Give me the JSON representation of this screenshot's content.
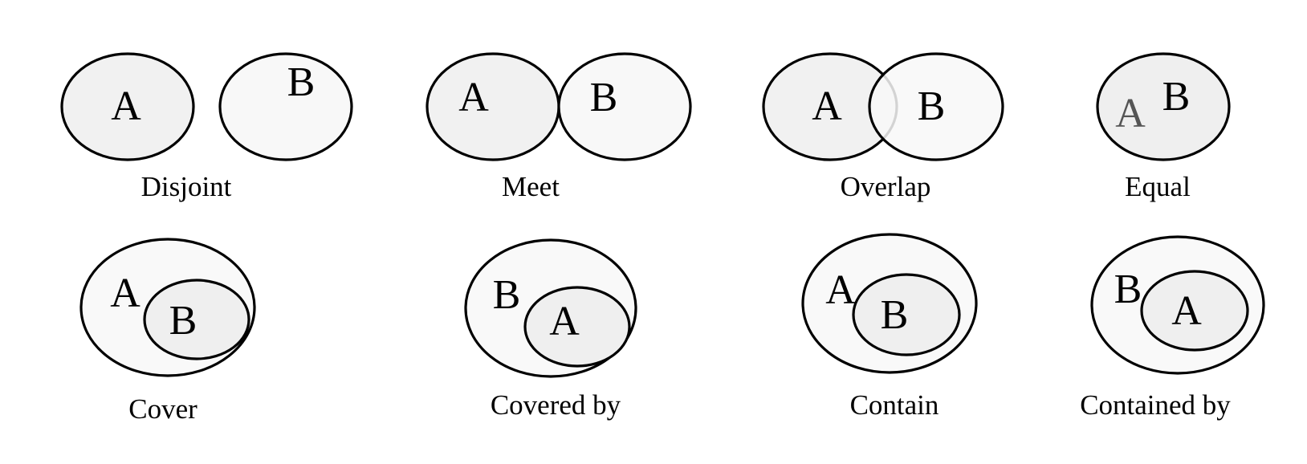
{
  "diagram": {
    "labels": {
      "a": "A",
      "b": "B"
    },
    "relations": [
      {
        "id": "disjoint",
        "caption": "Disjoint"
      },
      {
        "id": "meet",
        "caption": "Meet"
      },
      {
        "id": "overlap",
        "caption": "Overlap"
      },
      {
        "id": "equal",
        "caption": "Equal"
      },
      {
        "id": "cover",
        "caption": "Cover"
      },
      {
        "id": "covered-by",
        "caption": "Covered by"
      },
      {
        "id": "contain",
        "caption": "Contain"
      },
      {
        "id": "contained-by",
        "caption": "Contained by"
      }
    ]
  }
}
